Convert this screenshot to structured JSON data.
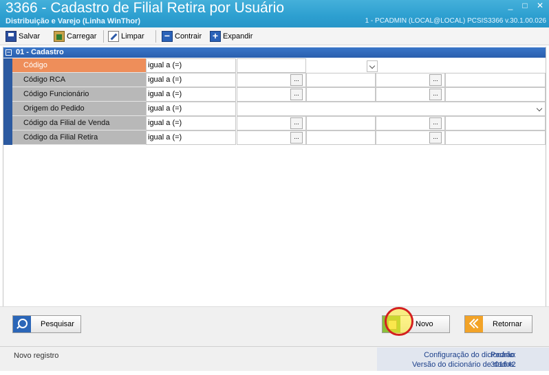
{
  "window": {
    "title": "3366 - Cadastro de Filial Retira por Usuário",
    "subtitle": "Distribuição e Varejo (Linha WinThor)",
    "session": "1 - PCADMIN (LOCAL@LOCAL)   PCSIS3366  v.30.1.00.026",
    "controls": {
      "minimize": "_",
      "maximize": "□",
      "close": "✕"
    }
  },
  "toolbar": {
    "save": "Salvar",
    "load": "Carregar",
    "clear": "Limpar",
    "collapse": "Contrair",
    "expand": "Expandir",
    "collapse_glyph": "−",
    "expand_glyph": "+"
  },
  "group": {
    "toggle": "−",
    "title": "01 - Cadastro"
  },
  "filters": [
    {
      "label": "Código",
      "operator": "igual a (=)",
      "selected": true
    },
    {
      "label": "Código RCA",
      "operator": "igual a (=)",
      "ellipsis": "..."
    },
    {
      "label": "Código Funcionário",
      "operator": "igual a (=)",
      "ellipsis": "..."
    },
    {
      "label": "Origem do Pedido",
      "operator": "igual a (=)"
    },
    {
      "label": "Código da Filial de Venda",
      "operator": "igual a (=)",
      "ellipsis": "..."
    },
    {
      "label": "Código da Filial Retira",
      "operator": "igual a (=)",
      "ellipsis": "..."
    }
  ],
  "actions": {
    "search": "Pesquisar",
    "new": "Novo",
    "return": "Retornar"
  },
  "status": {
    "text": "Novo registro",
    "dict_config_label": "Configuração do dicionário:",
    "dict_config_value": "Padrão",
    "dict_version_label": "Versão do dicionário de dados:",
    "dict_version_value": "301642"
  },
  "colors": {
    "titlebar": "#2d9fd0",
    "group_header": "#2a5fae",
    "selected_label": "#ee8e5a",
    "dictionary_text": "#1b3f8a"
  }
}
